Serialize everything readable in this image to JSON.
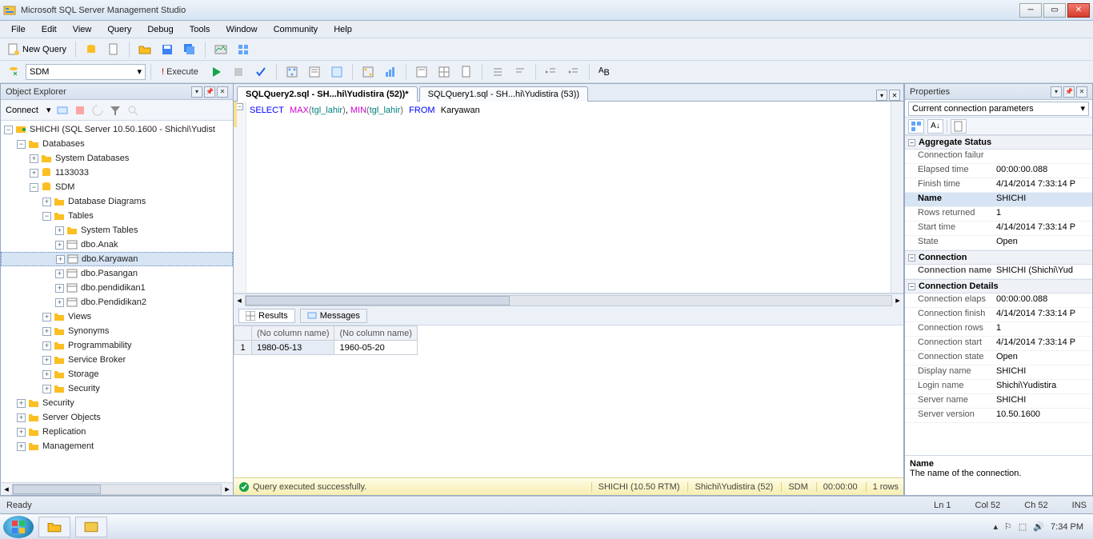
{
  "titlebar": {
    "title": "Microsoft SQL Server Management Studio"
  },
  "menu": [
    "File",
    "Edit",
    "View",
    "Query",
    "Debug",
    "Tools",
    "Window",
    "Community",
    "Help"
  ],
  "toolbar1": {
    "newQuery": "New Query"
  },
  "toolbar2": {
    "dbcombo": "SDM",
    "execute": "Execute"
  },
  "objectExplorer": {
    "title": "Object Explorer",
    "connect": "Connect",
    "tree": {
      "server": "SHICHI (SQL Server 10.50.1600 - Shichi\\Yudist",
      "databases": "Databases",
      "sysdb": "System Databases",
      "db1": "1133033",
      "db2": "SDM",
      "dd": "Database Diagrams",
      "tables": "Tables",
      "systables": "System Tables",
      "t1": "dbo.Anak",
      "t2": "dbo.Karyawan",
      "t3": "dbo.Pasangan",
      "t4": "dbo.pendidikan1",
      "t5": "dbo.Pendidikan2",
      "views": "Views",
      "syn": "Synonyms",
      "prog": "Programmability",
      "sb": "Service Broker",
      "storage": "Storage",
      "sec": "Security",
      "sec2": "Security",
      "so": "Server Objects",
      "rep": "Replication",
      "mgmt": "Management"
    }
  },
  "tabs": {
    "t1": "SQLQuery2.sql - SH...hi\\Yudistira (52))*",
    "t2": "SQLQuery1.sql - SH...hi\\Yudistira (53))"
  },
  "sql": {
    "kw1": "SELECT",
    "fn1": "MAX",
    "arg1": "tgl_lahir",
    "sep": ", ",
    "fn2": "MIN",
    "arg2": "tgl_lahir",
    "kw2": "FROM",
    "obj": "Karyawan"
  },
  "resultsTabs": {
    "results": "Results",
    "messages": "Messages"
  },
  "results": {
    "col1": "(No column name)",
    "col2": "(No column name)",
    "row1": "1",
    "v1": "1980-05-13",
    "v2": "1960-05-20"
  },
  "status": {
    "msg": "Query executed successfully.",
    "server": "SHICHI (10.50 RTM)",
    "user": "Shichi\\Yudistira (52)",
    "db": "SDM",
    "time": "00:00:00",
    "rows": "1 rows"
  },
  "properties": {
    "title": "Properties",
    "combo": "Current connection parameters",
    "groups": {
      "g1": "Aggregate Status",
      "g2": "Connection",
      "g3": "Connection Details"
    },
    "rows": [
      [
        "Connection failur",
        ""
      ],
      [
        "Elapsed time",
        "00:00:00.088"
      ],
      [
        "Finish time",
        "4/14/2014 7:33:14 P"
      ],
      [
        "Name",
        "SHICHI"
      ],
      [
        "Rows returned",
        "1"
      ],
      [
        "Start time",
        "4/14/2014 7:33:14 P"
      ],
      [
        "State",
        "Open"
      ]
    ],
    "rows2": [
      [
        "Connection name",
        "SHICHI (Shichi\\Yud"
      ]
    ],
    "rows3": [
      [
        "Connection elaps",
        "00:00:00.088"
      ],
      [
        "Connection finish",
        "4/14/2014 7:33:14 P"
      ],
      [
        "Connection rows",
        "1"
      ],
      [
        "Connection start",
        "4/14/2014 7:33:14 P"
      ],
      [
        "Connection state",
        "Open"
      ],
      [
        "Display name",
        "SHICHI"
      ],
      [
        "Login name",
        "Shichi\\Yudistira"
      ],
      [
        "Server name",
        "SHICHI"
      ],
      [
        "Server version",
        "10.50.1600"
      ]
    ],
    "help": {
      "title": "Name",
      "desc": "The name of the connection."
    }
  },
  "bottomStatus": {
    "ready": "Ready",
    "ln": "Ln 1",
    "col": "Col 52",
    "ch": "Ch 52",
    "ins": "INS"
  },
  "tray": {
    "clock": "7:34 PM"
  }
}
